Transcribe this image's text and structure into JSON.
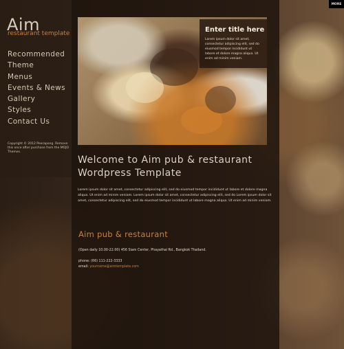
{
  "brand": {
    "logo": "Aim",
    "tagline": "restaurant template"
  },
  "nav": {
    "items": [
      {
        "label": "Recommended"
      },
      {
        "label": "Theme"
      },
      {
        "label": "Menus"
      },
      {
        "label": "Events & News"
      },
      {
        "label": "Gallery"
      },
      {
        "label": "Styles"
      },
      {
        "label": "Contact Us"
      }
    ]
  },
  "sidebar": {
    "copyright": "Copyright © 2012 Peerapong. Remove this once after purchase from the MOJO Themes."
  },
  "hero": {
    "title": "Enter title here",
    "text": "Lorem ipsum dolor sit amet, consectetur adipiscing elit, sed do eiusmod tempor incididunt ut labore et dolore magna aliqua. Ut enim ad minim veniam."
  },
  "main": {
    "welcome": "Welcome to Aim pub & restaurant Wordpress Template",
    "body": "Lorem ipsum dolor sit amet, consectetur adipiscing elit, sed do eiusmod tempor incididunt ut labore et dolore magna aliqua. Ut enim ad minim veniam. Lorem ipsum dolor sit amet, consectetur adipiscing elit, sed do Lorem ipsum dolor sit amet, consectetur adipiscing elit, sed do eiusmod tempor incididunt ut labore magna aliqua. Ut enim ad minim veniam."
  },
  "contact": {
    "title": "Aim pub & restaurant",
    "address": "(Open daily 10.00-22.00) 456 Siam Center, Phayathai Rd., Bangkok Thailand.",
    "phone": "phone: (66) 111-222-3333",
    "email_label": "email: ",
    "email": "yourname@aimtemplate.com"
  },
  "corner": {
    "more_label": "MORE"
  },
  "colors": {
    "accent": "#c7823f",
    "panel": "#2a1e14",
    "text": "#ddd3c4"
  }
}
